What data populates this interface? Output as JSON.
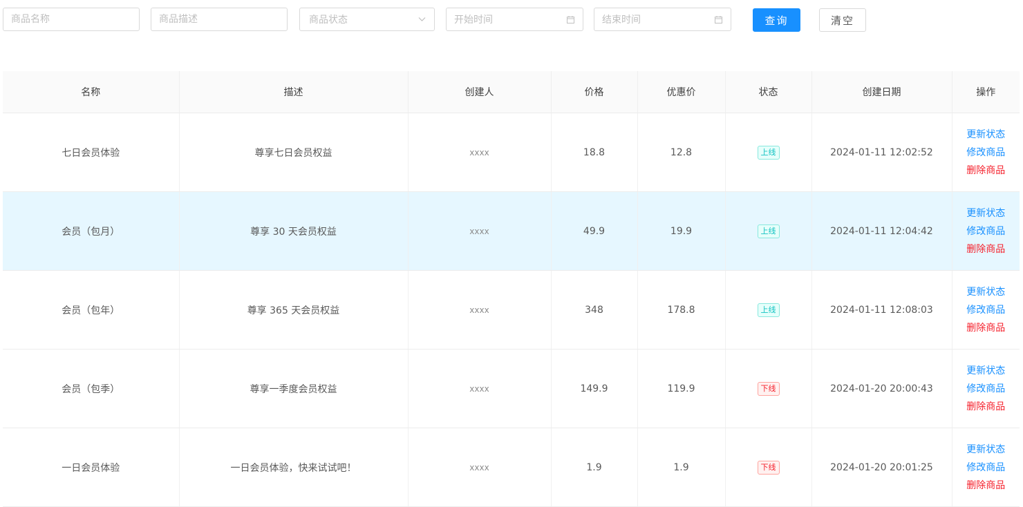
{
  "filters": {
    "name_placeholder": "商品名称",
    "desc_placeholder": "商品描述",
    "status_placeholder": "商品状态",
    "start_placeholder": "开始时间",
    "end_placeholder": "结束时间",
    "query_label": "查询",
    "clear_label": "清空"
  },
  "table": {
    "headers": {
      "name": "名称",
      "desc": "描述",
      "creator": "创建人",
      "price": "价格",
      "discount": "优惠价",
      "status": "状态",
      "created": "创建日期",
      "actions": "操作"
    },
    "actions": {
      "update_status": "更新状态",
      "edit": "修改商品",
      "delete": "删除商品"
    },
    "rows": [
      {
        "name": "七日会员体验",
        "desc": "尊享七日会员权益",
        "creator": "xxxx",
        "price": "18.8",
        "discount": "12.8",
        "status": "上线",
        "created": "2024-01-11 12:02:52"
      },
      {
        "name": "会员（包月）",
        "desc": "尊享 30 天会员权益",
        "creator": "xxxx",
        "price": "49.9",
        "discount": "19.9",
        "status": "上线",
        "created": "2024-01-11 12:04:42"
      },
      {
        "name": "会员（包年）",
        "desc": "尊享 365 天会员权益",
        "creator": "xxxx",
        "price": "348",
        "discount": "178.8",
        "status": "上线",
        "created": "2024-01-11 12:08:03"
      },
      {
        "name": "会员（包季）",
        "desc": "尊享一季度会员权益",
        "creator": "xxxx",
        "price": "149.9",
        "discount": "119.9",
        "status": "下线",
        "created": "2024-01-20 20:00:43"
      },
      {
        "name": "一日会员体验",
        "desc": "一日会员体验，快来试试吧！",
        "creator": "xxxx",
        "price": "1.9",
        "discount": "1.9",
        "status": "下线",
        "created": "2024-01-20 20:01:25"
      }
    ]
  },
  "colors": {
    "primary": "#1890ff",
    "danger": "#f5222d",
    "online_tag": "#13c2c2",
    "row_highlight": "#e6f7ff"
  },
  "icons": {
    "select_arrow": "chevron-down-icon",
    "date": "calendar-icon"
  }
}
